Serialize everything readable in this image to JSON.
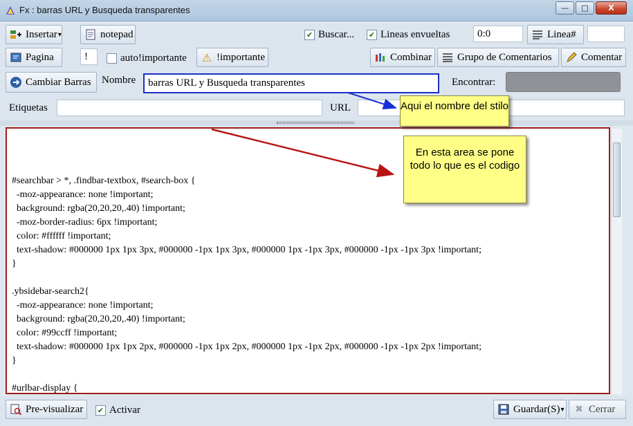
{
  "window": {
    "title": "Fx : barras URL y Busqueda transparentes",
    "minimize_glyph": "—",
    "maximize_glyph": "□",
    "close_glyph": "X"
  },
  "toolbar1": {
    "insertar": "Insertar",
    "dropdown_glyph": "▾",
    "notepad": "notepad",
    "buscar": "Buscar...",
    "lineas_envueltas": "Lineas envueltas",
    "position_value": "0:0",
    "linea": "Linea#",
    "linea_value": ""
  },
  "toolbar2": {
    "pagina": "Pagina",
    "bang_value": "!",
    "auto_important": "auto!importante",
    "important": "!importante",
    "combinar": "Combinar",
    "grupo": "Grupo de Comentarios",
    "comentar": "Comentar"
  },
  "toolbar3": {
    "cambiar_barras": "Cambiar Barras",
    "nombre_label": "Nombre",
    "nombre_value": "barras URL y Busqueda transparentes",
    "encontrar_label": "Encontrar:"
  },
  "toolbar4": {
    "etiquetas_label": "Etiquetas",
    "etiquetas_value": "",
    "url_label": "URL",
    "url_value": ""
  },
  "notes": {
    "name_note": "Aqui el nombre del stilo",
    "code_note": "En esta area se pone todo lo que es el codigo"
  },
  "code_lines": [
    "#searchbar > *, .findbar-textbox, #search-box {",
    "  -moz-appearance: none !important;",
    "  background: rgba(20,20,20,.40) !important;",
    "  -moz-border-radius: 6px !important;",
    "  color: #ffffff !important;",
    "  text-shadow: #000000 1px 1px 3px, #000000 -1px 1px 3px, #000000 1px -1px 3px, #000000 -1px -1px 3px !important;",
    "}",
    "",
    ".ybsidebar-search2{",
    "  -moz-appearance: none !important;",
    "  background: rgba(20,20,20,.40) !important;",
    "  color: #99ccff !important;",
    "  text-shadow: #000000 1px 1px 2px, #000000 -1px 1px 2px, #000000 1px -1px 2px, #000000 -1px -1px 2px !important;",
    "}",
    "",
    "#urlbar-display {"
  ],
  "bottom": {
    "previsualizar": "Pre-visualizar",
    "activar": "Activar",
    "guardar": "Guardar(S)",
    "cerrar": "Cerrar"
  },
  "icons": {
    "check": "✔",
    "warning": "⚠",
    "close_x": "✖"
  },
  "colors": {
    "highlight_border": "#1a2fc8",
    "code_border": "#a01c1c",
    "note_bg": "#ffff88",
    "arrow_blue": "#1530d8",
    "arrow_red": "#b81414"
  }
}
